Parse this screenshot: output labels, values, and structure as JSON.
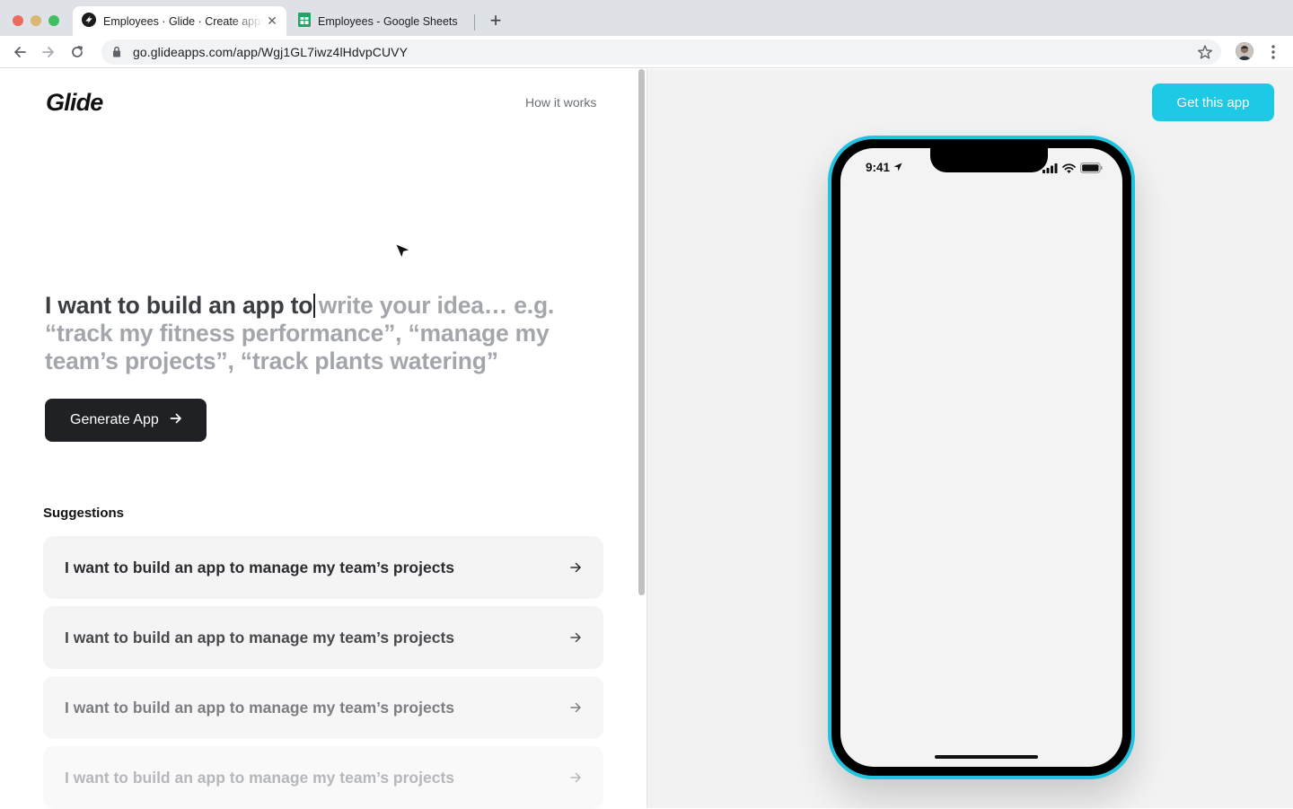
{
  "browser": {
    "tabs": [
      {
        "title": "Employees · Glide · Create apps from Google Sheets",
        "active": true,
        "icon": "glide-favicon-icon"
      },
      {
        "title": "Employees - Google Sheets",
        "active": false,
        "icon": "sheets-favicon-icon"
      }
    ],
    "url": "go.glideapps.com/app/Wgj1GL7iwz4lHdvpCUVY"
  },
  "left": {
    "logo": "Glide",
    "how_link": "How it works",
    "prompt_prefix": "I want to build an app to",
    "prompt_placeholder": "write your idea… e.g. “track my fitness performance”, “manage my team’s projects”, “track plants watering”",
    "generate_label": "Generate App",
    "suggestions_title": "Suggestions",
    "suggestions": [
      {
        "text": "I want to build an app to manage my team’s projects",
        "color": "#2a2c30"
      },
      {
        "text": "I want to build an app to manage my team’s projects",
        "color": "#48494d"
      },
      {
        "text": "I want to build an app to manage my team’s projects",
        "color": "#7b7d81"
      },
      {
        "text": "I want to build an app to manage my team’s projects",
        "color": "#b5b7ba"
      }
    ]
  },
  "right": {
    "get_app_label": "Get this app",
    "phone": {
      "time": "9:41"
    }
  },
  "colors": {
    "accent": "#1ec9e6",
    "dark_button": "#1f2124"
  }
}
